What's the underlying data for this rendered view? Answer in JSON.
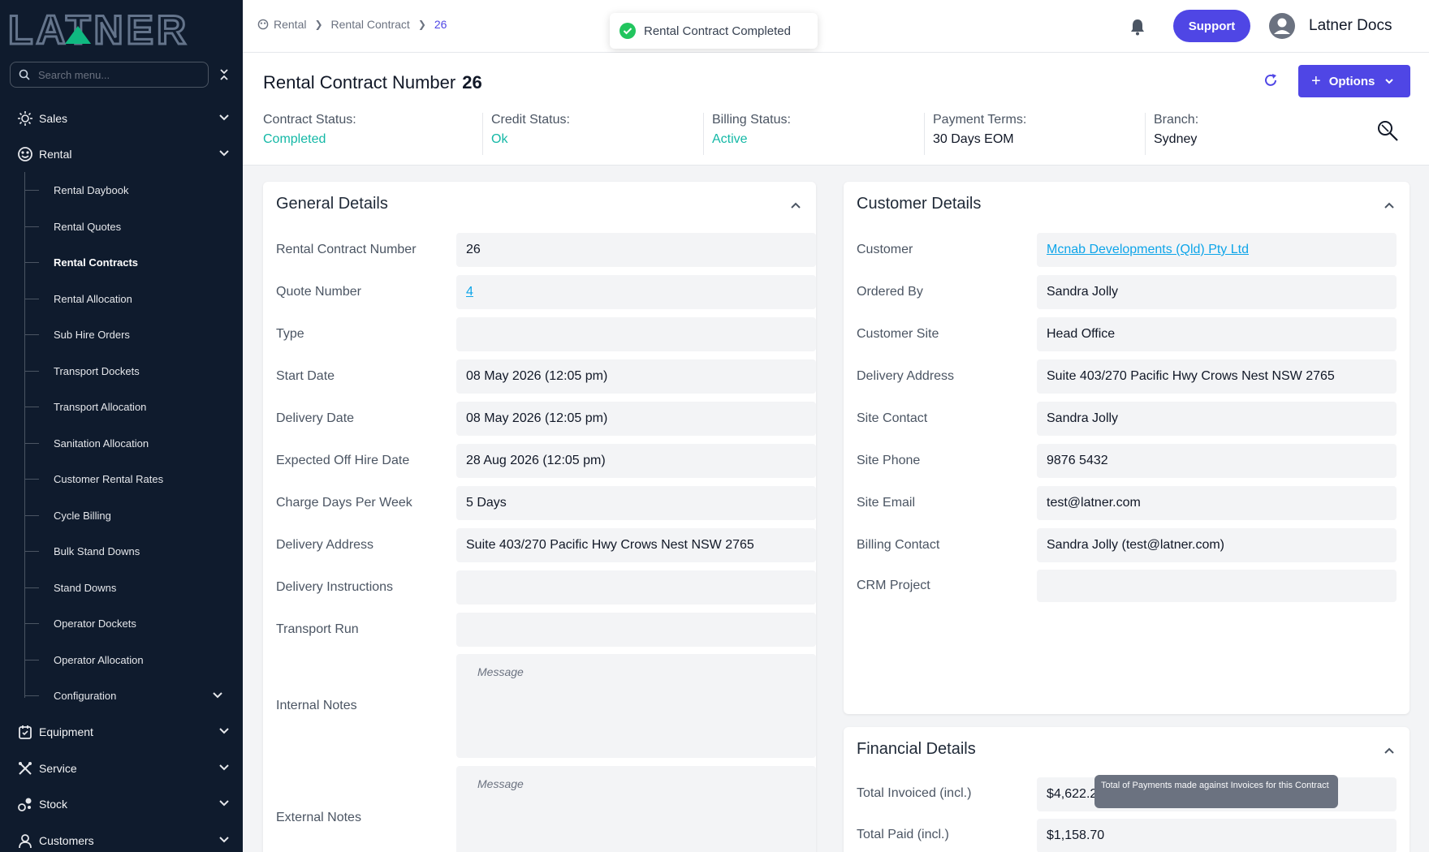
{
  "brand": {
    "logo_text": "LATNER"
  },
  "sidebar": {
    "search_placeholder": "Search menu...",
    "top_items": [
      {
        "label": "Sales",
        "icon": "sales-icon"
      },
      {
        "label": "Rental",
        "icon": "rental-icon"
      },
      {
        "label": "Equipment",
        "icon": "equipment-icon"
      },
      {
        "label": "Service",
        "icon": "service-icon"
      },
      {
        "label": "Stock",
        "icon": "stock-icon"
      },
      {
        "label": "Customers",
        "icon": "customers-icon"
      }
    ],
    "rental_items": [
      "Rental Daybook",
      "Rental Quotes",
      "Rental Contracts",
      "Rental Allocation",
      "Sub Hire Orders",
      "Transport Dockets",
      "Transport Allocation",
      "Sanitation Allocation",
      "Customer Rental Rates",
      "Cycle Billing",
      "Bulk Stand Downs",
      "Stand Downs",
      "Operator Dockets",
      "Operator Allocation",
      "Configuration"
    ],
    "active_item": "Rental Contracts"
  },
  "topbar": {
    "breadcrumb": [
      "Rental",
      "Rental Contract",
      "26"
    ],
    "toast": "Rental Contract Completed",
    "support_label": "Support",
    "user_name": "Latner Docs"
  },
  "header": {
    "title_label": "Rental Contract Number",
    "title_number": "26",
    "options_label": "Options",
    "statuses": [
      {
        "label": "Contract Status:",
        "value": "Completed"
      },
      {
        "label": "Credit Status:",
        "value": "Ok"
      },
      {
        "label": "Billing Status:",
        "value": "Active"
      },
      {
        "label": "Payment Terms:",
        "value": "30 Days EOM"
      },
      {
        "label": "Branch:",
        "value": "Sydney"
      }
    ]
  },
  "general": {
    "title": "General Details",
    "fields": [
      {
        "label": "Rental Contract Number",
        "value": "26"
      },
      {
        "label": "Quote Number",
        "value": "4"
      },
      {
        "label": "Type",
        "value": ""
      },
      {
        "label": "Start Date",
        "value": "08 May 2026 (12:05 pm)"
      },
      {
        "label": "Delivery Date",
        "value": "08 May 2026 (12:05 pm)"
      },
      {
        "label": "Expected Off Hire Date",
        "value": "28 Aug 2026 (12:05 pm)"
      },
      {
        "label": "Charge Days Per Week",
        "value": "5 Days"
      },
      {
        "label": "Delivery Address",
        "value": "Suite 403/270 Pacific Hwy Crows Nest NSW 2765"
      },
      {
        "label": "Delivery Instructions",
        "value": ""
      },
      {
        "label": "Transport Run",
        "value": ""
      }
    ],
    "internal_notes_label": "Internal Notes",
    "external_notes_label": "External Notes",
    "notes_placeholder": "Message"
  },
  "customer": {
    "title": "Customer Details",
    "fields": [
      {
        "label": "Customer",
        "value": "Mcnab Developments (Qld) Pty Ltd"
      },
      {
        "label": "Ordered By",
        "value": "Sandra Jolly"
      },
      {
        "label": "Customer Site",
        "value": "Head Office"
      },
      {
        "label": "Delivery Address",
        "value": "Suite 403/270 Pacific Hwy Crows Nest NSW 2765"
      },
      {
        "label": "Site Contact",
        "value": "Sandra Jolly"
      },
      {
        "label": "Site Phone",
        "value": "9876 5432"
      },
      {
        "label": "Site Email",
        "value": "test@latner.com"
      },
      {
        "label": "Billing Contact",
        "value": "Sandra Jolly (test@latner.com)"
      },
      {
        "label": "CRM Project",
        "value": ""
      }
    ]
  },
  "financial": {
    "title": "Financial Details",
    "fields": [
      {
        "label": "Total Invoiced (incl.)",
        "value": "$4,622.2"
      },
      {
        "label": "Total Paid (incl.)",
        "value": "$1,158.70"
      }
    ],
    "tooltip": "Total of Payments made against Invoices for this Contract"
  },
  "colors": {
    "accent": "#4f46e5",
    "sidebar": "#0f1b2d",
    "status_green": "#14b8a6",
    "link": "#0ea5e9"
  }
}
